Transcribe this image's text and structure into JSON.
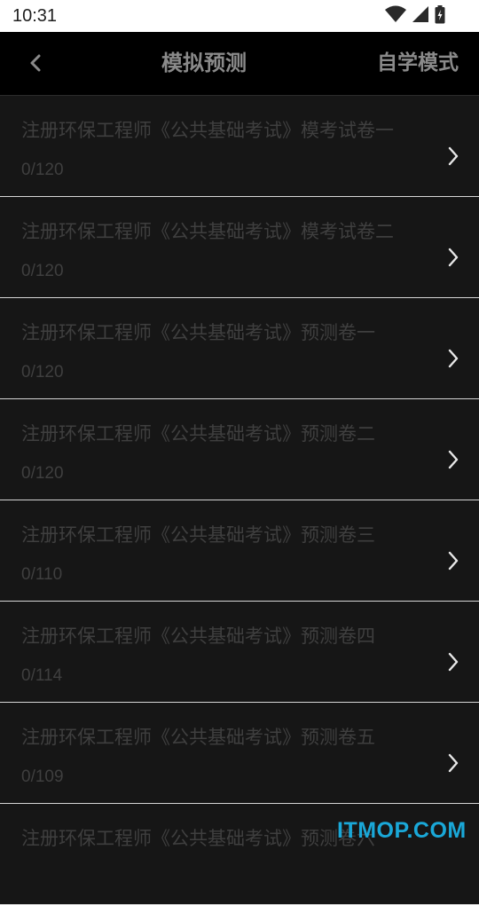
{
  "status_bar": {
    "time": "10:31",
    "icons": [
      "wifi-icon",
      "signal-icon",
      "battery-icon"
    ]
  },
  "app_bar": {
    "back_icon": "chevron-left-icon",
    "title": "模拟预测",
    "mode_button": "自学模式"
  },
  "papers": [
    {
      "title": "注册环保工程师《公共基础考试》模考试卷一",
      "progress": "0/120"
    },
    {
      "title": "注册环保工程师《公共基础考试》模考试卷二",
      "progress": "0/120"
    },
    {
      "title": "注册环保工程师《公共基础考试》预测卷一",
      "progress": "0/120"
    },
    {
      "title": "注册环保工程师《公共基础考试》预测卷二",
      "progress": "0/120"
    },
    {
      "title": "注册环保工程师《公共基础考试》预测卷三",
      "progress": "0/110"
    },
    {
      "title": "注册环保工程师《公共基础考试》预测卷四",
      "progress": "0/114"
    },
    {
      "title": "注册环保工程师《公共基础考试》预测卷五",
      "progress": "0/109"
    },
    {
      "title": "注册环保工程师《公共基础考试》预测卷六",
      "progress": ""
    }
  ],
  "watermark": "ITMOP.COM",
  "colors": {
    "background": "#161616",
    "app_bar": "#000000",
    "muted_text": "#3f3f3f",
    "title_text": "#8a8a8a",
    "watermark": "#1aa8d8"
  }
}
